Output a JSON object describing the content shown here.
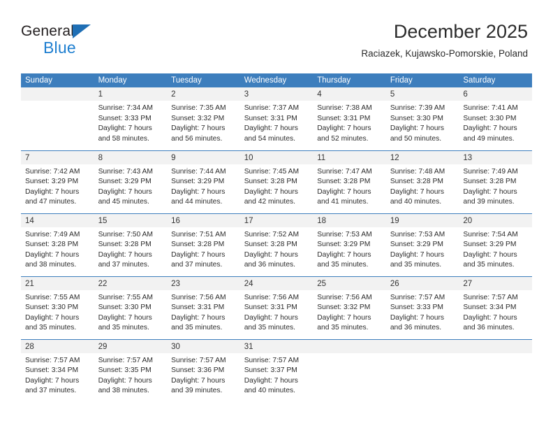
{
  "logo": {
    "word_one": "General",
    "word_two": "Blue",
    "triangle_color": "#1f6fb5",
    "blue_text_color": "#1f7fd0"
  },
  "header": {
    "title": "December 2025",
    "subtitle": "Raciazek, Kujawsko-Pomorskie, Poland",
    "header_bg": "#3d7ebd",
    "daynum_band_bg": "#f2f2f2"
  },
  "weekdays": [
    "Sunday",
    "Monday",
    "Tuesday",
    "Wednesday",
    "Thursday",
    "Friday",
    "Saturday"
  ],
  "weeks": [
    [
      {
        "day": "",
        "sunrise": "",
        "sunset": "",
        "daylight_line1": "",
        "daylight_line2": ""
      },
      {
        "day": "1",
        "sunrise": "Sunrise: 7:34 AM",
        "sunset": "Sunset: 3:33 PM",
        "daylight_line1": "Daylight: 7 hours",
        "daylight_line2": "and 58 minutes."
      },
      {
        "day": "2",
        "sunrise": "Sunrise: 7:35 AM",
        "sunset": "Sunset: 3:32 PM",
        "daylight_line1": "Daylight: 7 hours",
        "daylight_line2": "and 56 minutes."
      },
      {
        "day": "3",
        "sunrise": "Sunrise: 7:37 AM",
        "sunset": "Sunset: 3:31 PM",
        "daylight_line1": "Daylight: 7 hours",
        "daylight_line2": "and 54 minutes."
      },
      {
        "day": "4",
        "sunrise": "Sunrise: 7:38 AM",
        "sunset": "Sunset: 3:31 PM",
        "daylight_line1": "Daylight: 7 hours",
        "daylight_line2": "and 52 minutes."
      },
      {
        "day": "5",
        "sunrise": "Sunrise: 7:39 AM",
        "sunset": "Sunset: 3:30 PM",
        "daylight_line1": "Daylight: 7 hours",
        "daylight_line2": "and 50 minutes."
      },
      {
        "day": "6",
        "sunrise": "Sunrise: 7:41 AM",
        "sunset": "Sunset: 3:30 PM",
        "daylight_line1": "Daylight: 7 hours",
        "daylight_line2": "and 49 minutes."
      }
    ],
    [
      {
        "day": "7",
        "sunrise": "Sunrise: 7:42 AM",
        "sunset": "Sunset: 3:29 PM",
        "daylight_line1": "Daylight: 7 hours",
        "daylight_line2": "and 47 minutes."
      },
      {
        "day": "8",
        "sunrise": "Sunrise: 7:43 AM",
        "sunset": "Sunset: 3:29 PM",
        "daylight_line1": "Daylight: 7 hours",
        "daylight_line2": "and 45 minutes."
      },
      {
        "day": "9",
        "sunrise": "Sunrise: 7:44 AM",
        "sunset": "Sunset: 3:29 PM",
        "daylight_line1": "Daylight: 7 hours",
        "daylight_line2": "and 44 minutes."
      },
      {
        "day": "10",
        "sunrise": "Sunrise: 7:45 AM",
        "sunset": "Sunset: 3:28 PM",
        "daylight_line1": "Daylight: 7 hours",
        "daylight_line2": "and 42 minutes."
      },
      {
        "day": "11",
        "sunrise": "Sunrise: 7:47 AM",
        "sunset": "Sunset: 3:28 PM",
        "daylight_line1": "Daylight: 7 hours",
        "daylight_line2": "and 41 minutes."
      },
      {
        "day": "12",
        "sunrise": "Sunrise: 7:48 AM",
        "sunset": "Sunset: 3:28 PM",
        "daylight_line1": "Daylight: 7 hours",
        "daylight_line2": "and 40 minutes."
      },
      {
        "day": "13",
        "sunrise": "Sunrise: 7:49 AM",
        "sunset": "Sunset: 3:28 PM",
        "daylight_line1": "Daylight: 7 hours",
        "daylight_line2": "and 39 minutes."
      }
    ],
    [
      {
        "day": "14",
        "sunrise": "Sunrise: 7:49 AM",
        "sunset": "Sunset: 3:28 PM",
        "daylight_line1": "Daylight: 7 hours",
        "daylight_line2": "and 38 minutes."
      },
      {
        "day": "15",
        "sunrise": "Sunrise: 7:50 AM",
        "sunset": "Sunset: 3:28 PM",
        "daylight_line1": "Daylight: 7 hours",
        "daylight_line2": "and 37 minutes."
      },
      {
        "day": "16",
        "sunrise": "Sunrise: 7:51 AM",
        "sunset": "Sunset: 3:28 PM",
        "daylight_line1": "Daylight: 7 hours",
        "daylight_line2": "and 37 minutes."
      },
      {
        "day": "17",
        "sunrise": "Sunrise: 7:52 AM",
        "sunset": "Sunset: 3:28 PM",
        "daylight_line1": "Daylight: 7 hours",
        "daylight_line2": "and 36 minutes."
      },
      {
        "day": "18",
        "sunrise": "Sunrise: 7:53 AM",
        "sunset": "Sunset: 3:29 PM",
        "daylight_line1": "Daylight: 7 hours",
        "daylight_line2": "and 35 minutes."
      },
      {
        "day": "19",
        "sunrise": "Sunrise: 7:53 AM",
        "sunset": "Sunset: 3:29 PM",
        "daylight_line1": "Daylight: 7 hours",
        "daylight_line2": "and 35 minutes."
      },
      {
        "day": "20",
        "sunrise": "Sunrise: 7:54 AM",
        "sunset": "Sunset: 3:29 PM",
        "daylight_line1": "Daylight: 7 hours",
        "daylight_line2": "and 35 minutes."
      }
    ],
    [
      {
        "day": "21",
        "sunrise": "Sunrise: 7:55 AM",
        "sunset": "Sunset: 3:30 PM",
        "daylight_line1": "Daylight: 7 hours",
        "daylight_line2": "and 35 minutes."
      },
      {
        "day": "22",
        "sunrise": "Sunrise: 7:55 AM",
        "sunset": "Sunset: 3:30 PM",
        "daylight_line1": "Daylight: 7 hours",
        "daylight_line2": "and 35 minutes."
      },
      {
        "day": "23",
        "sunrise": "Sunrise: 7:56 AM",
        "sunset": "Sunset: 3:31 PM",
        "daylight_line1": "Daylight: 7 hours",
        "daylight_line2": "and 35 minutes."
      },
      {
        "day": "24",
        "sunrise": "Sunrise: 7:56 AM",
        "sunset": "Sunset: 3:31 PM",
        "daylight_line1": "Daylight: 7 hours",
        "daylight_line2": "and 35 minutes."
      },
      {
        "day": "25",
        "sunrise": "Sunrise: 7:56 AM",
        "sunset": "Sunset: 3:32 PM",
        "daylight_line1": "Daylight: 7 hours",
        "daylight_line2": "and 35 minutes."
      },
      {
        "day": "26",
        "sunrise": "Sunrise: 7:57 AM",
        "sunset": "Sunset: 3:33 PM",
        "daylight_line1": "Daylight: 7 hours",
        "daylight_line2": "and 36 minutes."
      },
      {
        "day": "27",
        "sunrise": "Sunrise: 7:57 AM",
        "sunset": "Sunset: 3:34 PM",
        "daylight_line1": "Daylight: 7 hours",
        "daylight_line2": "and 36 minutes."
      }
    ],
    [
      {
        "day": "28",
        "sunrise": "Sunrise: 7:57 AM",
        "sunset": "Sunset: 3:34 PM",
        "daylight_line1": "Daylight: 7 hours",
        "daylight_line2": "and 37 minutes."
      },
      {
        "day": "29",
        "sunrise": "Sunrise: 7:57 AM",
        "sunset": "Sunset: 3:35 PM",
        "daylight_line1": "Daylight: 7 hours",
        "daylight_line2": "and 38 minutes."
      },
      {
        "day": "30",
        "sunrise": "Sunrise: 7:57 AM",
        "sunset": "Sunset: 3:36 PM",
        "daylight_line1": "Daylight: 7 hours",
        "daylight_line2": "and 39 minutes."
      },
      {
        "day": "31",
        "sunrise": "Sunrise: 7:57 AM",
        "sunset": "Sunset: 3:37 PM",
        "daylight_line1": "Daylight: 7 hours",
        "daylight_line2": "and 40 minutes."
      },
      {
        "day": "",
        "sunrise": "",
        "sunset": "",
        "daylight_line1": "",
        "daylight_line2": ""
      },
      {
        "day": "",
        "sunrise": "",
        "sunset": "",
        "daylight_line1": "",
        "daylight_line2": ""
      },
      {
        "day": "",
        "sunrise": "",
        "sunset": "",
        "daylight_line1": "",
        "daylight_line2": ""
      }
    ]
  ]
}
